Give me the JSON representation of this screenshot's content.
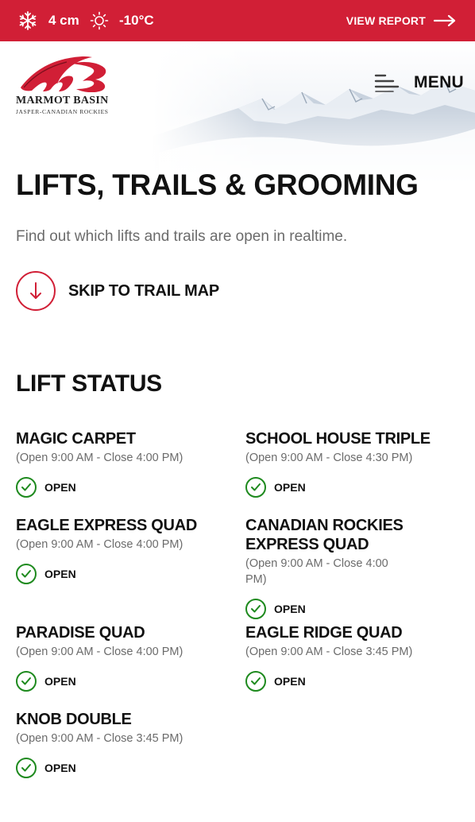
{
  "topbar": {
    "snow_icon": "snowflake-icon",
    "snow": "4 cm",
    "weather_icon": "sun-icon",
    "temperature": "-10°C",
    "view_report": "VIEW REPORT",
    "arrow_icon": "arrow-right-icon"
  },
  "brand": {
    "name": "MARMOT BASIN",
    "tagline": "JASPER-CANADIAN ROCKIES",
    "color": "#d11f36"
  },
  "menu": {
    "label": "MENU",
    "icon": "hamburger-icon"
  },
  "page": {
    "title": "LIFTS, TRAILS & GROOMING",
    "intro": "Find out which lifts and trails are open in realtime.",
    "skip_label": "SKIP TO TRAIL MAP"
  },
  "lift_status": {
    "title": "LIFT STATUS",
    "open_color": "#1e8a1e",
    "lifts": [
      {
        "name": "MAGIC CARPET",
        "hours": "(Open 9:00 AM - Close 4:00 PM)",
        "status": "OPEN"
      },
      {
        "name": "SCHOOL HOUSE TRIPLE",
        "hours": "(Open 9:00 AM - Close 4:30 PM)",
        "status": "OPEN"
      },
      {
        "name": "EAGLE EXPRESS QUAD",
        "hours": "(Open 9:00 AM - Close 4:00 PM)",
        "status": "OPEN"
      },
      {
        "name": "CANADIAN ROCKIES EXPRESS QUAD",
        "hours": "(Open 9:00 AM - Close 4:00 PM)",
        "status": "OPEN"
      },
      {
        "name": "PARADISE QUAD",
        "hours": "(Open 9:00 AM - Close 4:00 PM)",
        "status": "OPEN"
      },
      {
        "name": "EAGLE RIDGE QUAD",
        "hours": "(Open 9:00 AM - Close 3:45 PM)",
        "status": "OPEN"
      },
      {
        "name": "KNOB DOUBLE",
        "hours": "(Open 9:00 AM - Close 3:45 PM)",
        "status": "OPEN"
      }
    ]
  }
}
